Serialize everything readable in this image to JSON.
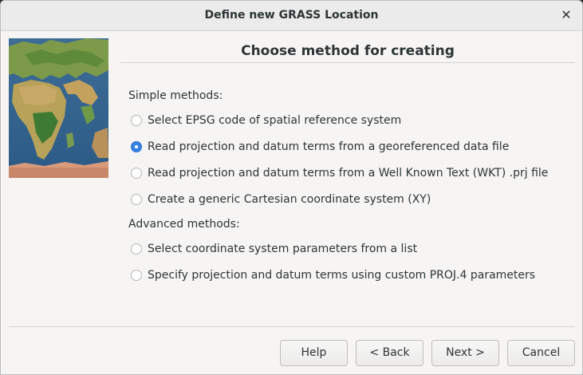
{
  "window": {
    "title": "Define new GRASS Location",
    "close_label": "✕"
  },
  "page": {
    "heading": "Choose method for creating"
  },
  "simple": {
    "label": "Simple methods:",
    "options": [
      {
        "label": "Select EPSG code of spatial reference system",
        "selected": false
      },
      {
        "label": "Read projection and datum terms from a georeferenced data file",
        "selected": true
      },
      {
        "label": "Read projection and datum terms from a Well Known Text (WKT) .prj file",
        "selected": false
      },
      {
        "label": "Create a generic Cartesian coordinate system (XY)",
        "selected": false
      }
    ]
  },
  "advanced": {
    "label": "Advanced methods:",
    "options": [
      {
        "label": "Select coordinate system parameters from a list",
        "selected": false
      },
      {
        "label": "Specify projection and datum terms using custom PROJ.4 parameters",
        "selected": false
      }
    ]
  },
  "buttons": {
    "help": "Help",
    "back": "< Back",
    "next": "Next >",
    "cancel": "Cancel"
  },
  "colors": {
    "accent": "#3584e4",
    "window_bg": "#f6f5f4"
  }
}
